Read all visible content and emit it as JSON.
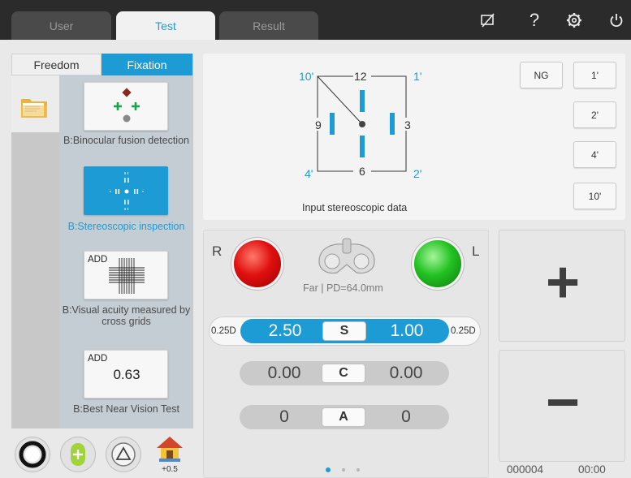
{
  "tabs": {
    "user": "User",
    "test": "Test",
    "result": "Result"
  },
  "toolbar": {
    "icons": [
      "no-screen-icon",
      "help-icon",
      "settings-icon",
      "power-icon"
    ],
    "help_glyph": "?"
  },
  "mode_tabs": {
    "freedom": "Freedom",
    "fixation": "Fixation"
  },
  "modes": [
    {
      "label": "B:Binocular fusion detection"
    },
    {
      "label": "B:Stereoscopic inspection"
    },
    {
      "label": "B:Visual acuity measured by cross grids",
      "badge": "ADD"
    },
    {
      "label": "B:Best Near Vision Test",
      "badge": "ADD",
      "value": "0.63"
    }
  ],
  "bottom_icons": {
    "add_label": "+0.5"
  },
  "stereo": {
    "labels": {
      "n12": "12",
      "n9": "9",
      "n3": "3",
      "n6": "6",
      "tl": "10'",
      "tr": "1'",
      "bl": "4'",
      "br": "2'"
    },
    "caption": "Input stereoscopic data",
    "buttons": {
      "ng": "NG",
      "b1": "1'",
      "b2": "2'",
      "b4": "4'",
      "b10": "10'"
    }
  },
  "measure": {
    "right_eye": "R",
    "left_eye": "L",
    "right_eye_color": "#e01010",
    "left_eye_color": "#22c222",
    "distance_info": "Far | PD=64.0mm",
    "sphere": {
      "step_left": "0.25D",
      "right": "2.50",
      "key": "S",
      "left": "1.00",
      "step_right": "0.25D"
    },
    "cylinder": {
      "right": "0.00",
      "key": "C",
      "left": "0.00"
    },
    "axis": {
      "right": "0",
      "key": "A",
      "left": "0"
    }
  },
  "controls": {
    "plus": "+",
    "minus": "−"
  },
  "footer": {
    "counter": "000004",
    "time": "00:00"
  },
  "colors": {
    "accent": "#1d9bd4",
    "topbar": "#2b2b2b"
  }
}
